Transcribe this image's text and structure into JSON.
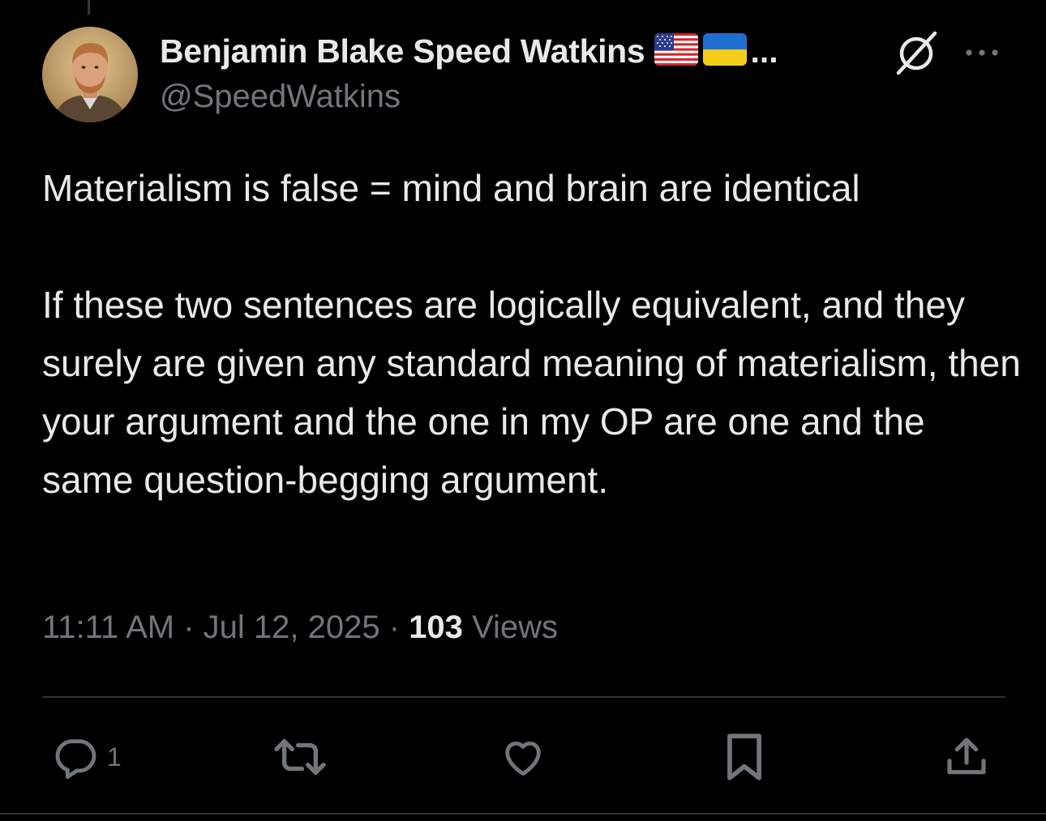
{
  "author": {
    "display_name": "Benjamin Blake Speed Watkins",
    "name_truncation": "...",
    "handle": "@SpeedWatkins",
    "flags": [
      "us-flag-icon",
      "ukraine-flag-icon"
    ]
  },
  "tweet": {
    "paragraphs": [
      "Materialism is false = mind and brain are identical",
      "If these two sentences are logically equivalent, and they surely are given any standard meaning of materialism, then your argument and the one in my OP are one and the same question-begging argument."
    ]
  },
  "meta": {
    "time": "11:11 AM",
    "separator": "·",
    "date": "Jul 12, 2025",
    "views_count": "103",
    "views_label": "Views"
  },
  "actions": {
    "reply_count": "1",
    "icons": [
      "reply-icon",
      "retweet-icon",
      "like-icon",
      "bookmark-icon",
      "share-icon"
    ]
  },
  "colors": {
    "background": "#000000",
    "primary_text": "#e7e9ea",
    "secondary_text": "#71767b",
    "divider": "#2f3336"
  }
}
